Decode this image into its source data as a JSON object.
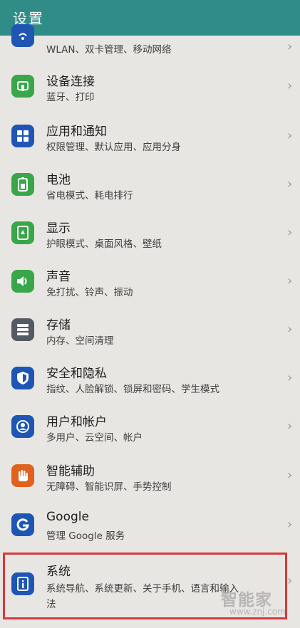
{
  "header": {
    "title": "设置"
  },
  "items": [
    {
      "icon": "wifi-icon",
      "title": "",
      "subtitle": "WLAN、双卡管理、移动网络",
      "color": "#1f56b3"
    },
    {
      "icon": "device-connection-icon",
      "title": "设备连接",
      "subtitle": "蓝牙、打印",
      "color": "#3aa64a"
    },
    {
      "icon": "apps-grid-icon",
      "title": "应用和通知",
      "subtitle": "权限管理、默认应用、应用分身",
      "color": "#1f56b3"
    },
    {
      "icon": "battery-icon",
      "title": "电池",
      "subtitle": "省电模式、耗电排行",
      "color": "#3aa64a"
    },
    {
      "icon": "display-icon",
      "title": "显示",
      "subtitle": "护眼模式、桌面风格、壁纸",
      "color": "#3aa64a"
    },
    {
      "icon": "sound-icon",
      "title": "声音",
      "subtitle": "免打扰、铃声、振动",
      "color": "#3aa64a"
    },
    {
      "icon": "storage-icon",
      "title": "存储",
      "subtitle": "内存、空间清理",
      "color": "#555b63"
    },
    {
      "icon": "shield-icon",
      "title": "安全和隐私",
      "subtitle": "指纹、人脸解锁、锁屏和密码、学生模式",
      "color": "#1f56b3"
    },
    {
      "icon": "user-account-icon",
      "title": "用户和帐户",
      "subtitle": "多用户、云空间、帐户",
      "color": "#1f56b3"
    },
    {
      "icon": "hand-icon",
      "title": "智能辅助",
      "subtitle": "无障碍、智能识屏、手势控制",
      "color": "#e0621e"
    },
    {
      "icon": "google-icon",
      "title": "Google",
      "subtitle": "管理 Google 服务",
      "color": "#1f56b3"
    },
    {
      "icon": "system-info-icon",
      "title": "系统",
      "subtitle": "系统导航、系统更新、关于手机、语言和输入",
      "subtitle2": "法",
      "color": "#1f56b3"
    }
  ],
  "chevron": "›",
  "watermark": {
    "brand": "智能家",
    "url": "www.znj.com"
  }
}
